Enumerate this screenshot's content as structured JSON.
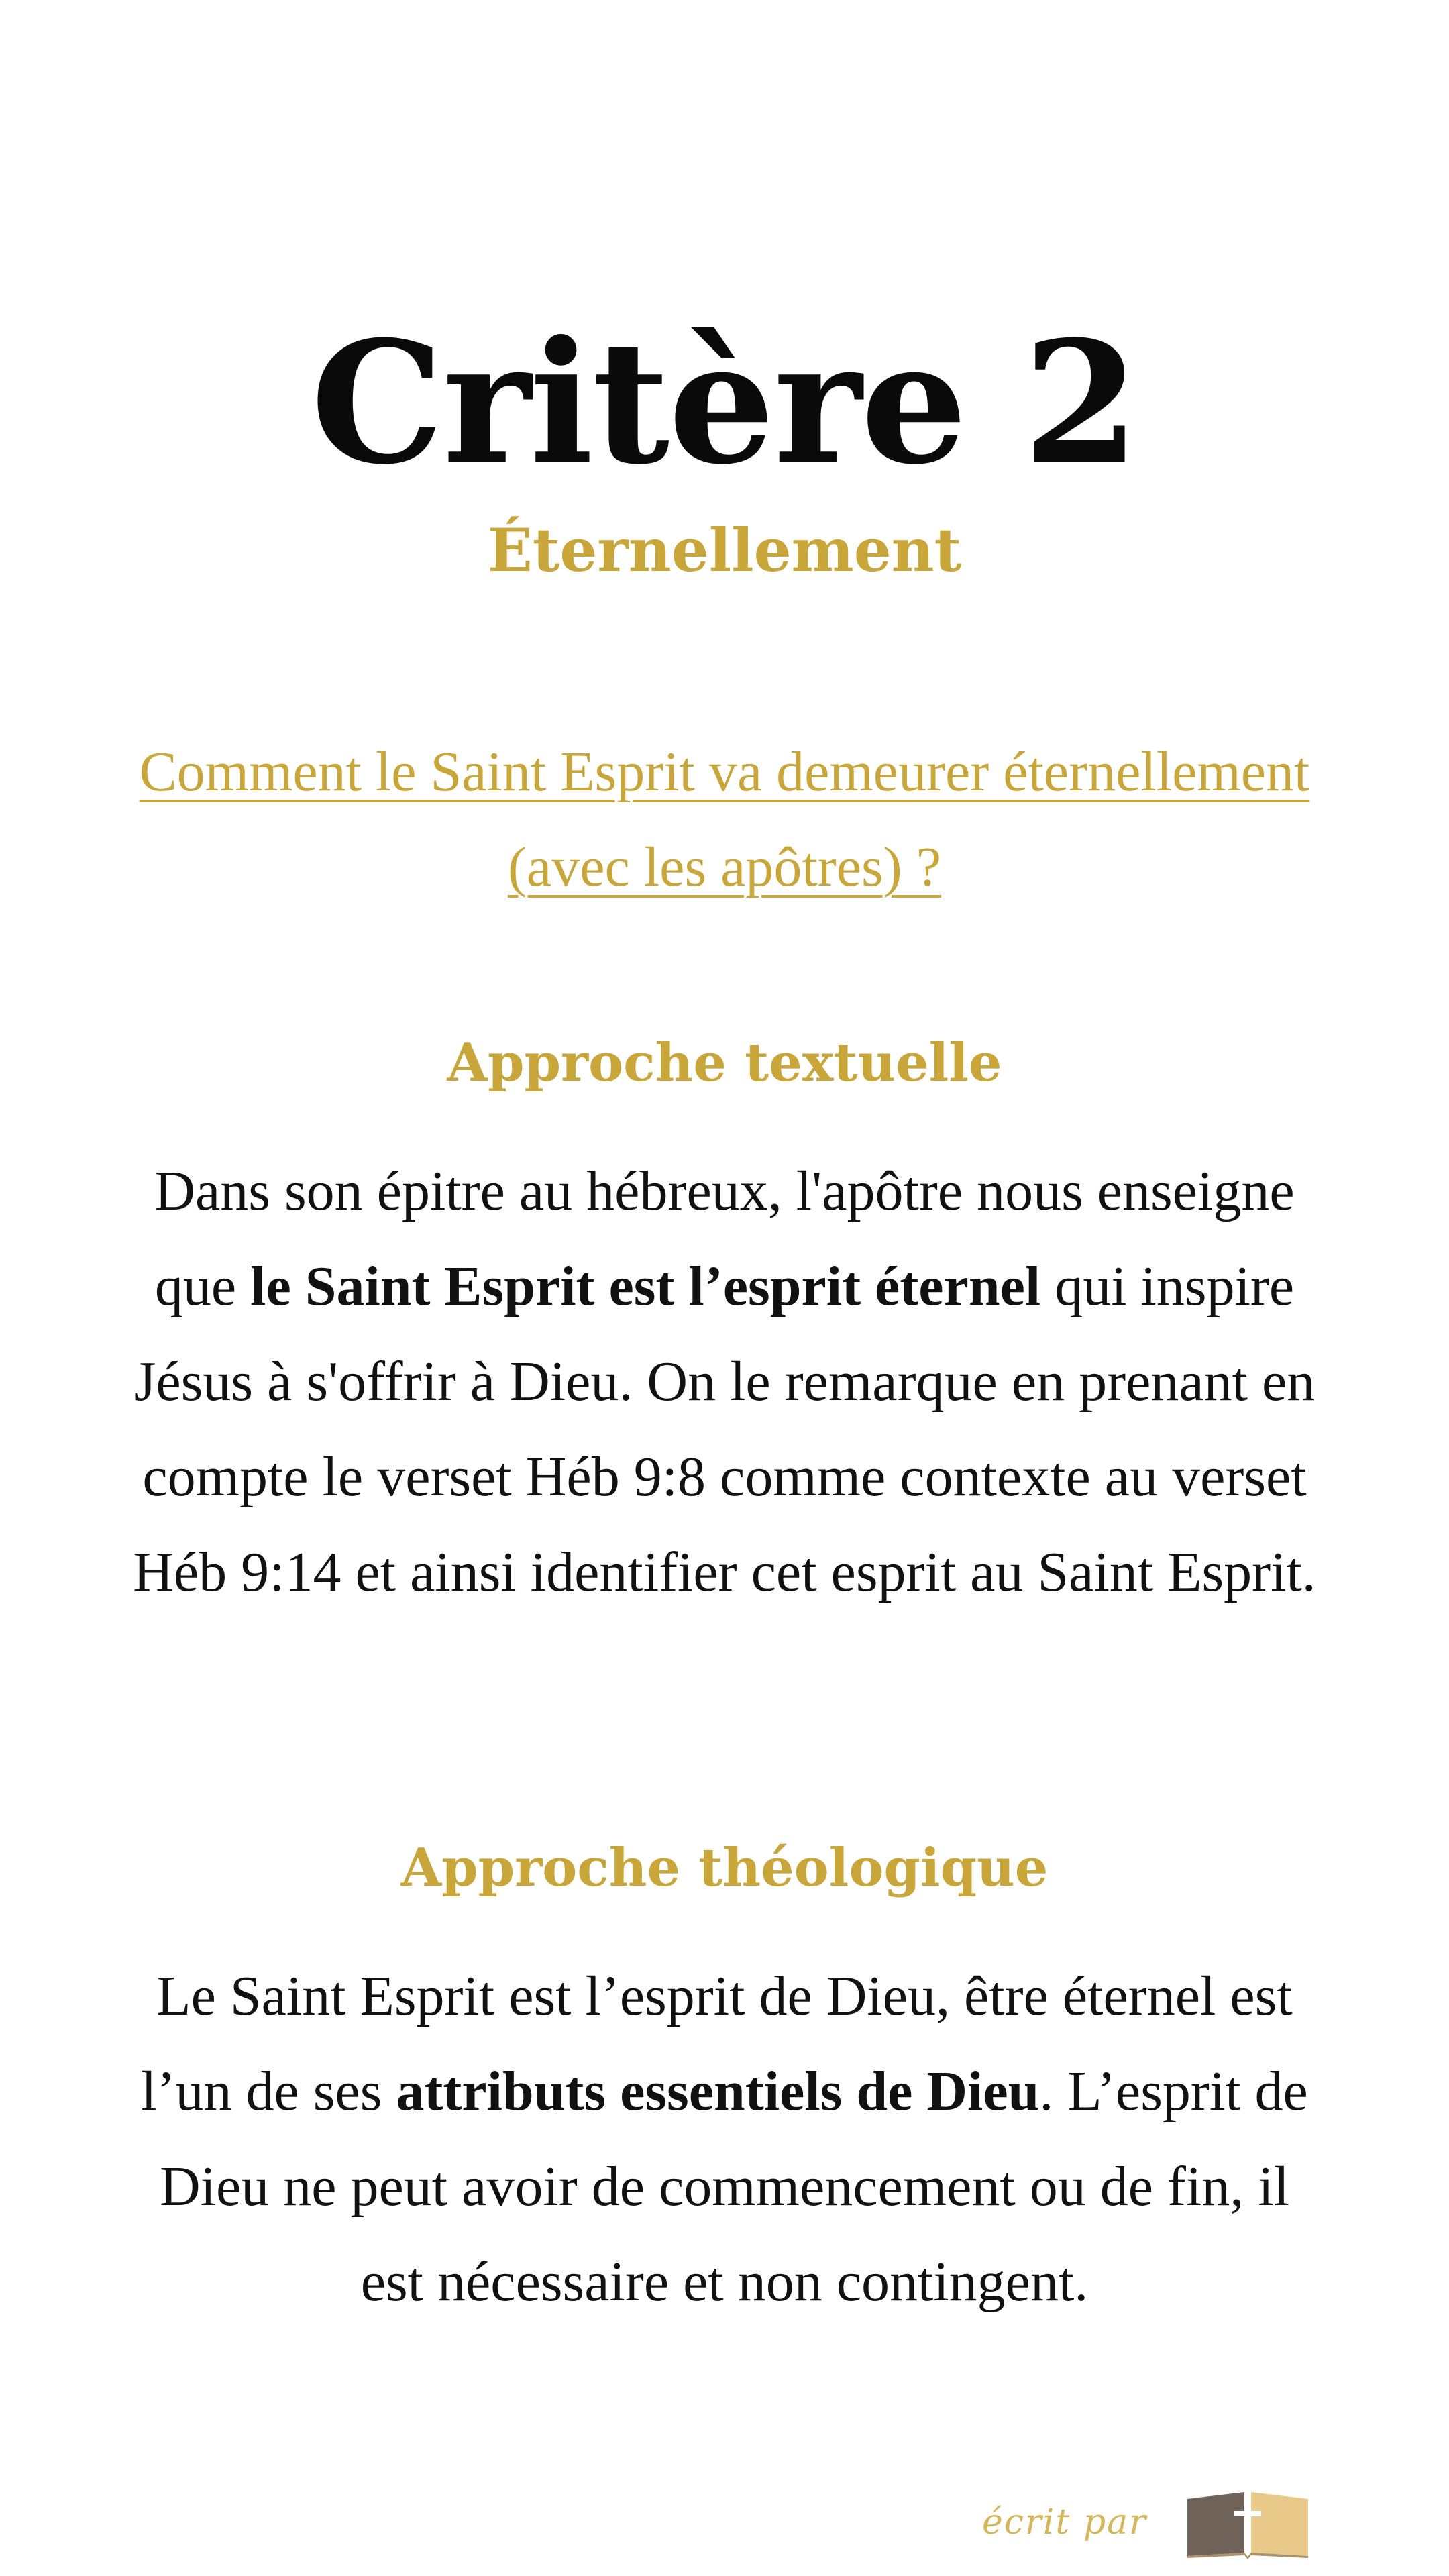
{
  "title": "Critère 2",
  "subtitle": "Éternellement",
  "question": "Comment le Saint Esprit va demeurer éternellement (avec les apôtres) ?",
  "section1": {
    "heading": "Approche textuelle",
    "text_before": "Dans son épitre au hébreux, l'apôtre nous enseigne que ",
    "text_bold": "le Saint Esprit est l’esprit éternel",
    "text_after": " qui inspire Jésus à s'offrir à Dieu. On le remarque en prenant en compte le verset Héb 9:8 comme contexte au verset Héb 9:14 et ainsi identifier cet esprit au Saint Esprit."
  },
  "section2": {
    "heading": "Approche théologique",
    "text_before": "Le Saint Esprit est l’esprit de Dieu, être éternel est l’un de ses ",
    "text_bold": "attributs essentiels de Dieu",
    "text_after": ". L’esprit de Dieu ne peut avoir de commencement ou de fin, il est nécessaire et non contingent."
  },
  "footer": {
    "signature": "écrit par",
    "logo_icon": "open-bible-cross-icon"
  },
  "colors": {
    "accent_gold": "#c9a63a",
    "text_dark": "#111111",
    "background": "#ffffff",
    "logo_dark": "#6f6258",
    "logo_light": "#e8c98a"
  }
}
